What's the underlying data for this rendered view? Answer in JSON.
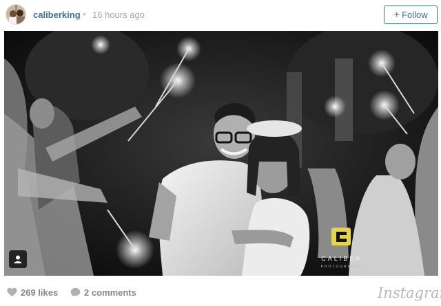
{
  "post": {
    "username": "caliberking",
    "separator": "•",
    "timestamp": "16 hours ago",
    "follow_label": "Follow",
    "follow_icon": "+"
  },
  "photo": {
    "watermark_main": "CALIBER",
    "watermark_sub": "PHOTOGRAPHY"
  },
  "stats": {
    "likes": "269 likes",
    "comments": "2 comments"
  },
  "brand": {
    "logo_text": "Instagram"
  },
  "colors": {
    "accent": "#3f729b",
    "muted": "#a5a7aa",
    "watermark": "#e8d44a"
  },
  "icons": [
    "avatar",
    "heart-icon",
    "comment-icon",
    "user-tag-icon",
    "caliber-logo-icon"
  ]
}
